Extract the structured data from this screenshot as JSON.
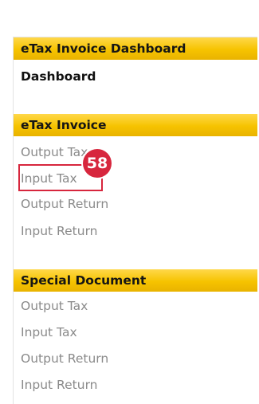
{
  "dashboard_section": {
    "header": "eTax Invoice Dashboard",
    "item": "Dashboard"
  },
  "etax_section": {
    "header": "eTax Invoice",
    "items": [
      "Output Tax",
      "Input Tax",
      "Output Return",
      "Input Return"
    ]
  },
  "special_section": {
    "header": "Special Document",
    "items": [
      "Output Tax",
      "Input Tax",
      "Output Return",
      "Input Return"
    ]
  },
  "annotation": {
    "step_number": "58",
    "color": "#d7263d"
  },
  "colors": {
    "header_bg": "#f6c300",
    "item_text": "#8a8a8a",
    "bold_text": "#111111"
  }
}
